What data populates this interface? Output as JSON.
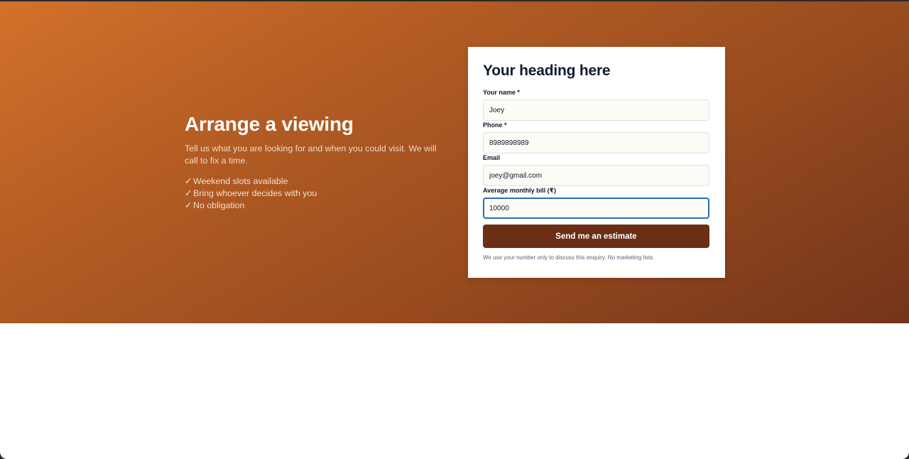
{
  "hero": {
    "title": "Arrange a viewing",
    "description": "Tell us what you are looking for and when you could visit. We will call to fix a time.",
    "features": [
      "Weekend slots available",
      "Bring whoever decides with you",
      "No obligation"
    ],
    "check_glyph": "✓"
  },
  "form": {
    "title": "Your heading here",
    "fields": [
      {
        "label": "Your name *",
        "value": "Joey"
      },
      {
        "label": "Phone *",
        "value": "8989898989"
      },
      {
        "label": "Email",
        "value": "joey@gmail.com"
      },
      {
        "label": "Average monthly bill (₹)",
        "value": "10000"
      }
    ],
    "submit_label": "Send me an estimate",
    "note": "We use your number only to discuss this enquiry. No marketing lists."
  },
  "colors": {
    "hero_gradient_start": "#d2722b",
    "hero_gradient_end": "#73341a",
    "button": "#6b2f16",
    "focus_border": "#2a6fb3"
  }
}
